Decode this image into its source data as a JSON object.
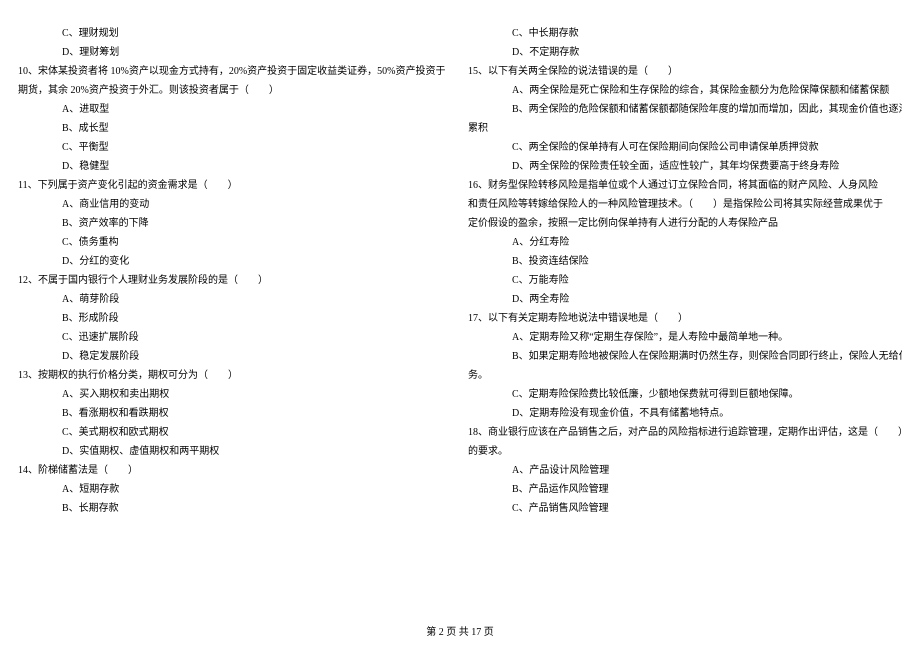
{
  "left": {
    "pre_opts": [
      "C、理财规划",
      "D、理财筹划"
    ],
    "q10": "10、宋体某投资者将 10%资产以现金方式持有，20%资产投资于固定收益类证券，50%资产投资于",
    "q10_cont": "期货，其余 20%资产投资于外汇。则该投资者属于（　　）",
    "q10_opts": [
      "A、进取型",
      "B、成长型",
      "C、平衡型",
      "D、稳健型"
    ],
    "q11": "11、下列属于资产变化引起的资金需求是（　　）",
    "q11_opts": [
      "A、商业信用的变动",
      "B、资产效率的下降",
      "C、债务重构",
      "D、分红的变化"
    ],
    "q12": "12、不属于国内银行个人理财业务发展阶段的是（　　）",
    "q12_opts": [
      "A、萌芽阶段",
      "B、形成阶段",
      "C、迅速扩展阶段",
      "D、稳定发展阶段"
    ],
    "q13": "13、按期权的执行价格分类，期权可分为（　　）",
    "q13_opts": [
      "A、买入期权和卖出期权",
      "B、看涨期权和看跌期权",
      "C、美式期权和欧式期权",
      "D、实值期权、虚值期权和两平期权"
    ],
    "q14": "14、阶梯储蓄法是（　　）",
    "q14_opts": [
      "A、短期存款",
      "B、长期存款"
    ]
  },
  "right": {
    "pre_opts": [
      "C、中长期存款",
      "D、不定期存款"
    ],
    "q15": "15、以下有关两全保险的说法错误的是（　　）",
    "q15_opts": [
      "A、两全保险是死亡保险和生存保险的综合，其保险金额分为危险保障保额和储蓄保额",
      "B、两全保险的危险保额和储蓄保额都随保险年度的增加而增加，因此，其现金价值也逐渐",
      "C、两全保险的保单持有人可在保险期间向保险公司申请保单质押贷款",
      "D、两全保险的保险责任较全面，适应性较广，其年均保费要高于终身寿险"
    ],
    "q15_acc": "累积",
    "q16": "16、财务型保险转移风险是指单位或个人通过订立保险合同，将其面临的财产风险、人身风险",
    "q16_c2": "和责任风险等转嫁给保险人的一种风险管理技术。（　　）是指保险公司将其实际经营成果优于",
    "q16_c3": "定价假设的盈余，按照一定比例向保单持有人进行分配的人寿保险产品",
    "q16_opts": [
      "A、分红寿险",
      "B、投资连结保险",
      "C、万能寿险",
      "D、两全寿险"
    ],
    "q17": "17、以下有关定期寿险地说法中错误地是（　　）",
    "q17_opts": [
      "A、定期寿险又称“定期生存保险”，是人寿险中最简单地一种。",
      "B、如果定期寿险地被保险人在保险期满时仍然生存，则保险合同即行终止，保险人无给付义",
      "C、定期寿险保险费比较低廉，少额地保费就可得到巨额地保障。",
      "D、定期寿险没有现金价值，不具有储蓄地特点。"
    ],
    "q17_acc": "务。",
    "q18": "18、商业银行应该在产品销售之后，对产品的风险指标进行追踪管理，定期作出评估，这是（　　）",
    "q18_c2": "的要求。",
    "q18_opts": [
      "A、产品设计风险管理",
      "B、产品运作风险管理",
      "C、产品销售风险管理"
    ]
  },
  "footer": "第 2 页 共 17 页"
}
